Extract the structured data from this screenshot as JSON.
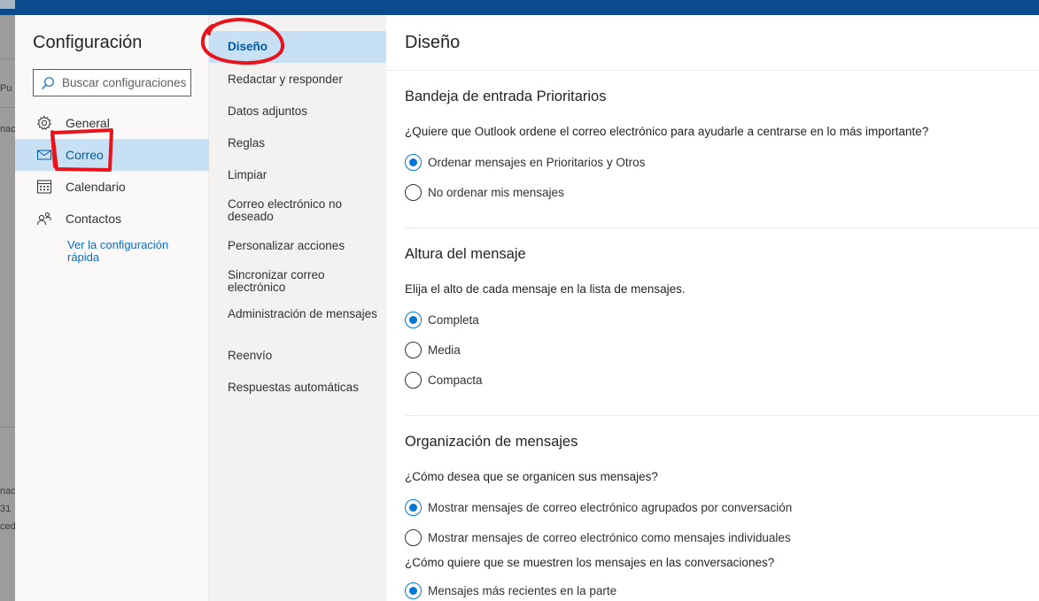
{
  "background_app": {
    "fragments": [
      "Pu",
      "nac",
      "nac",
      "31",
      "ced"
    ]
  },
  "settings": {
    "title": "Configuración",
    "search": {
      "placeholder": "Buscar configuraciones"
    },
    "categories": [
      {
        "label": "General",
        "icon": "gear-icon",
        "active": false
      },
      {
        "label": "Correo",
        "icon": "mail-icon",
        "active": true
      },
      {
        "label": "Calendario",
        "icon": "calendar-icon",
        "active": false
      },
      {
        "label": "Contactos",
        "icon": "people-icon",
        "active": false
      }
    ],
    "quick_settings_link": "Ver la configuración rápida"
  },
  "mail_nav": {
    "items": [
      {
        "label": "Diseño",
        "active": true
      },
      {
        "label": "Redactar y responder"
      },
      {
        "label": "Datos adjuntos"
      },
      {
        "label": "Reglas"
      },
      {
        "label": "Limpiar"
      },
      {
        "label": "Correo electrónico no deseado"
      },
      {
        "label": "Personalizar acciones"
      },
      {
        "label": "Sincronizar correo electrónico"
      },
      {
        "label": "Administración de mensajes"
      },
      {
        "label": "Reenvío"
      },
      {
        "label": "Respuestas automáticas"
      }
    ]
  },
  "content": {
    "title": "Diseño",
    "sections": [
      {
        "title": "Bandeja de entrada Prioritarios",
        "question": "¿Quiere que Outlook ordene el correo electrónico para ayudarle a centrarse en lo más importante?",
        "options": [
          {
            "label": "Ordenar mensajes en Prioritarios y Otros",
            "checked": true
          },
          {
            "label": "No ordenar mis mensajes",
            "checked": false
          }
        ]
      },
      {
        "title": "Altura del mensaje",
        "question": "Elija el alto de cada mensaje en la lista de mensajes.",
        "options": [
          {
            "label": "Completa",
            "checked": true
          },
          {
            "label": "Media",
            "checked": false
          },
          {
            "label": "Compacta",
            "checked": false
          }
        ]
      },
      {
        "title": "Organización de mensajes",
        "question": "¿Cómo desea que se organicen sus mensajes?",
        "options": [
          {
            "label": "Mostrar mensajes de correo electrónico agrupados por conversación",
            "checked": true
          },
          {
            "label": "Mostrar mensajes de correo electrónico como mensajes individuales",
            "checked": false
          }
        ],
        "question2": "¿Cómo quiere que se muestren los mensajes en las conversaciones?",
        "options2": [
          {
            "label": "Mensajes más recientes en la parte",
            "checked": true
          }
        ]
      }
    ]
  },
  "colors": {
    "accent": "#0078d4",
    "selected_background": "#c7e0f4",
    "annotation": "#e8141c"
  }
}
